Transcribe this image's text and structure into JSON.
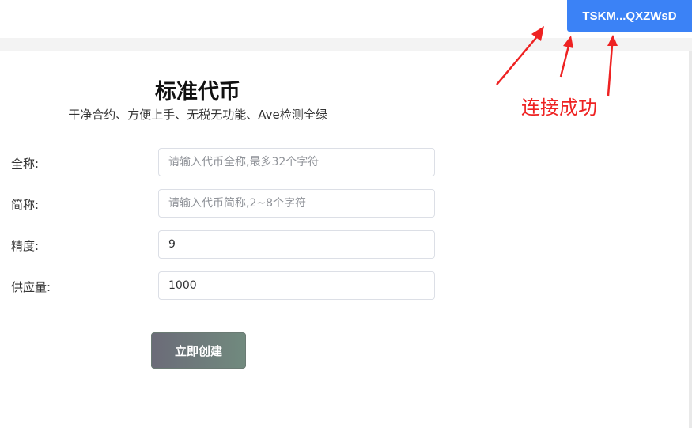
{
  "header": {
    "wallet_address": "TSKM...QXZWsD"
  },
  "main": {
    "title": "标准代币",
    "subtitle": "干净合约、方便上手、无税无功能、Ave检测全绿",
    "fields": [
      {
        "label": "全称:",
        "value": "",
        "placeholder": "请输入代币全称,最多32个字符"
      },
      {
        "label": "简称:",
        "value": "",
        "placeholder": "请输入代币简称,2~8个字符"
      },
      {
        "label": "精度:",
        "value": "9",
        "placeholder": ""
      },
      {
        "label": "供应量:",
        "value": "1000",
        "placeholder": ""
      }
    ],
    "submit_label": "立即创建"
  },
  "annotation": {
    "text": "连接成功",
    "color": "#ee2222"
  },
  "colors": {
    "accent": "#3b82f6"
  }
}
